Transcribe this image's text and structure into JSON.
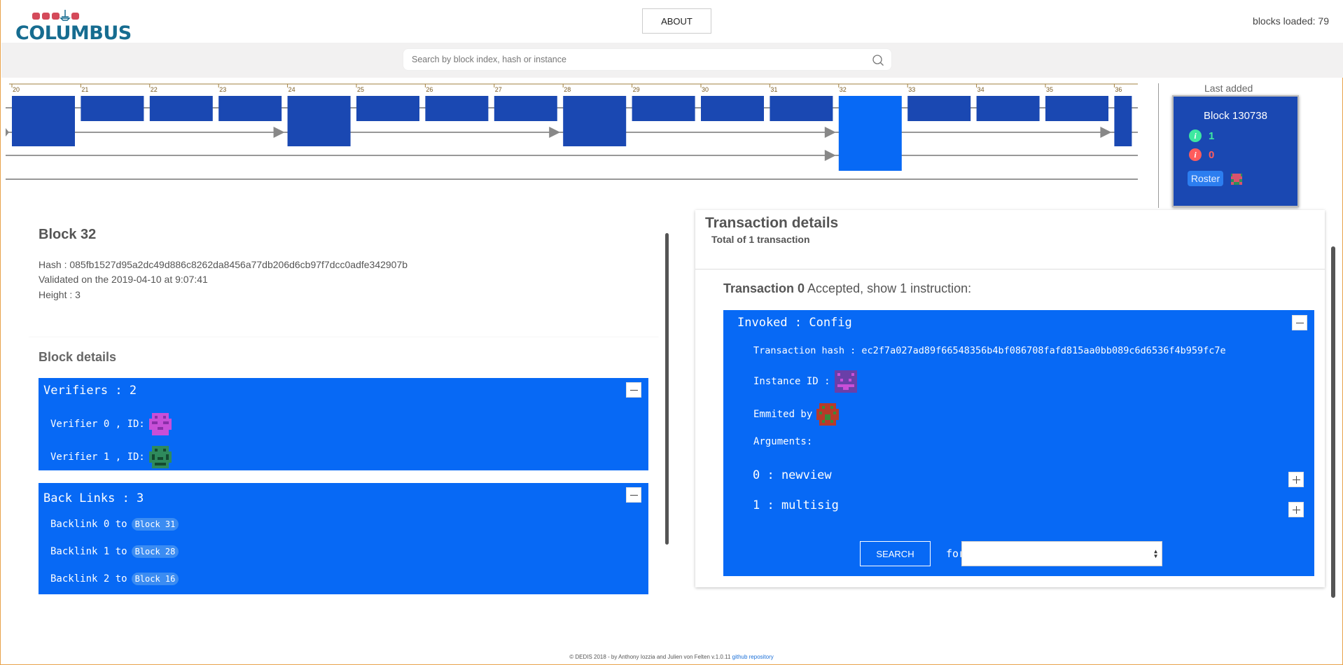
{
  "header": {
    "logo_text": "COLUMBUS",
    "about_label": "ABOUT",
    "blocks_loaded": "blocks loaded: 79"
  },
  "search": {
    "placeholder": "Search by block index, hash or instance"
  },
  "timeline": {
    "indices": [
      "20",
      "21",
      "22",
      "23",
      "24",
      "25",
      "26",
      "27",
      "28",
      "29",
      "30",
      "31",
      "32",
      "33",
      "34",
      "35",
      "36"
    ],
    "selected_index": "32"
  },
  "last_added": {
    "label": "Last added",
    "block_title": "Block 130738",
    "accepted_count": "1",
    "rejected_count": "0",
    "roster_label": "Roster"
  },
  "block": {
    "title": "Block 32",
    "hash_line": "Hash : 085fb1527d95a2dc49d886c8262da8456a77db206d6cb97f7dcc0adfe342907b",
    "validated_line": "Validated on the 2019-04-10 at 9:07:41",
    "height_line": "Height : 3"
  },
  "block_details": {
    "title": "Block details",
    "verifiers_title": "Verifiers : 2",
    "verifier0": "Verifier 0 , ID:",
    "verifier1": "Verifier 1 , ID:",
    "backlinks_title": "Back Links : 3",
    "backlink0": "Backlink 0 to",
    "backlink0_block": "Block 31",
    "backlink1": "Backlink 1 to",
    "backlink1_block": "Block 28",
    "backlink2": "Backlink 2 to",
    "backlink2_block": "Block 16"
  },
  "tx_details": {
    "title": "Transaction details",
    "total": "Total of 1 transaction",
    "tx_label": "Transaction 0",
    "tx_status": " Accepted, show 1 instruction:",
    "invoked": "Invoked : Config",
    "tx_hash": "Transaction hash : ec2f7a027ad89f66548356b4bf086708fafd815aa0bb089c6d6536f4b959fc7e",
    "instance_id": "Instance ID :",
    "emitted_by": "Emmited by",
    "arguments": "Arguments:",
    "arg0": "0 : newview",
    "arg1": "1 : multisig",
    "search_label": "SEARCH",
    "for_label": "for"
  },
  "footer": {
    "text": "© DEDIS 2018 - by Anthony Iozzia and Julien von Felten v.1.0.11 ",
    "link": "github repository"
  },
  "colors": {
    "block_blue": "#1a48b2",
    "selected_blue": "#0769f5",
    "accept_green": "#3ee8a0",
    "reject_red": "#ff5c5c"
  }
}
